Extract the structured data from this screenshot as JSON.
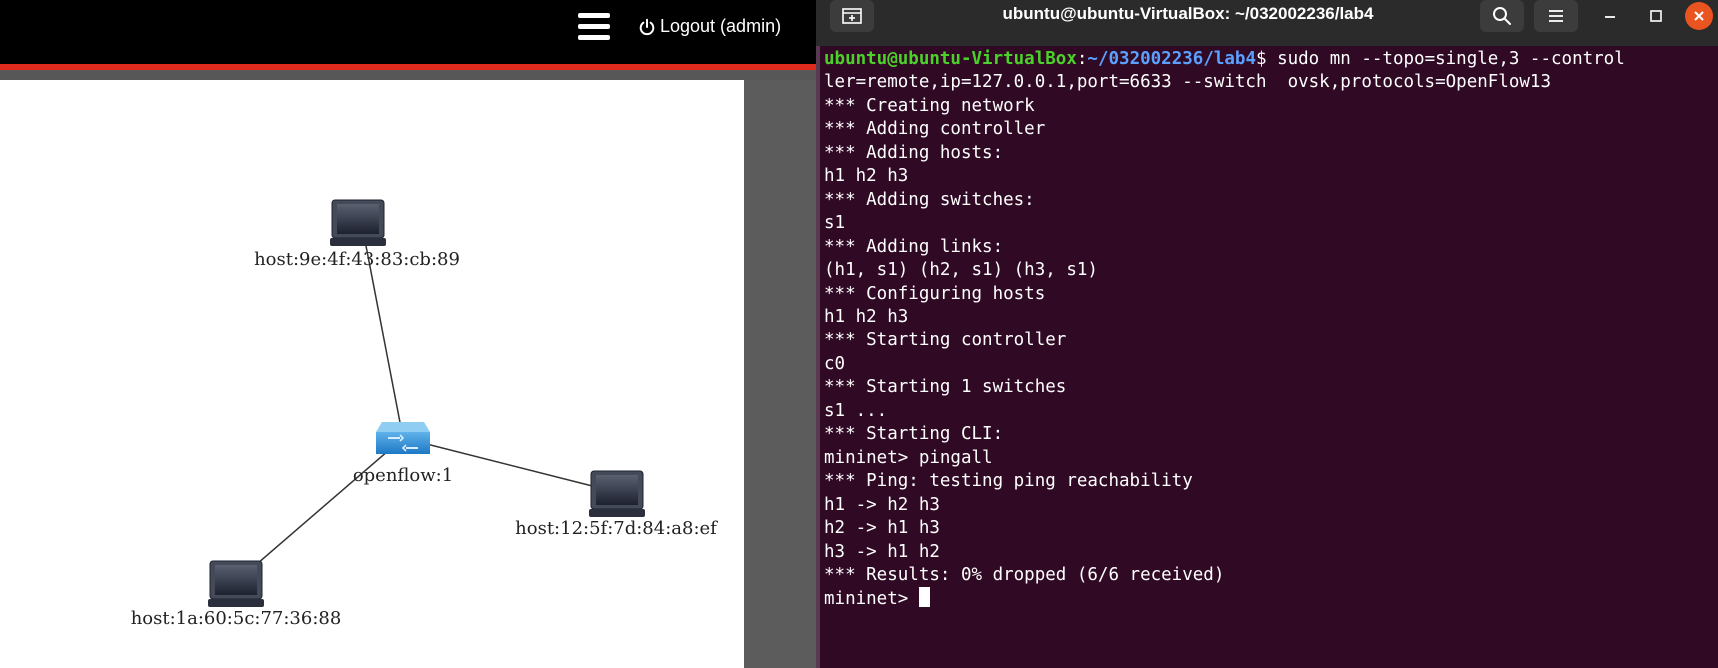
{
  "web": {
    "logout_label": "Logout (admin)",
    "topology": {
      "switch_label": "openflow:1",
      "hosts": [
        "host:9e:4f:43:83:cb:89",
        "host:12:5f:7d:84:a8:ef",
        "host:1a:60:5c:77:36:88"
      ]
    }
  },
  "terminal": {
    "title": "ubuntu@ubuntu-VirtualBox: ~/032002236/lab4",
    "prompt_user": "ubuntu@ubuntu-VirtualBox",
    "prompt_path": "~/032002236/lab4",
    "command": "$ sudo mn --topo=single,3 --control",
    "command_cont": "ler=remote,ip=127.0.0.1,port=6633 --switch  ovsk,protocols=OpenFlow13",
    "output": [
      "*** Creating network",
      "*** Adding controller",
      "*** Adding hosts:",
      "h1 h2 h3",
      "*** Adding switches:",
      "s1",
      "*** Adding links:",
      "(h1, s1) (h2, s1) (h3, s1)",
      "*** Configuring hosts",
      "h1 h2 h3",
      "*** Starting controller",
      "c0",
      "*** Starting 1 switches",
      "s1 ...",
      "*** Starting CLI:",
      "mininet> pingall",
      "*** Ping: testing ping reachability",
      "h1 -> h2 h3",
      "h2 -> h1 h3",
      "h3 -> h1 h2",
      "*** Results: 0% dropped (6/6 received)"
    ],
    "final_prompt": "mininet> "
  },
  "colors": {
    "terminal_bg": "#300a24",
    "prompt_user": "#4bd12a",
    "prompt_path": "#5aa0ff",
    "accent_red": "#e02a1d",
    "close_orange": "#e95420"
  }
}
